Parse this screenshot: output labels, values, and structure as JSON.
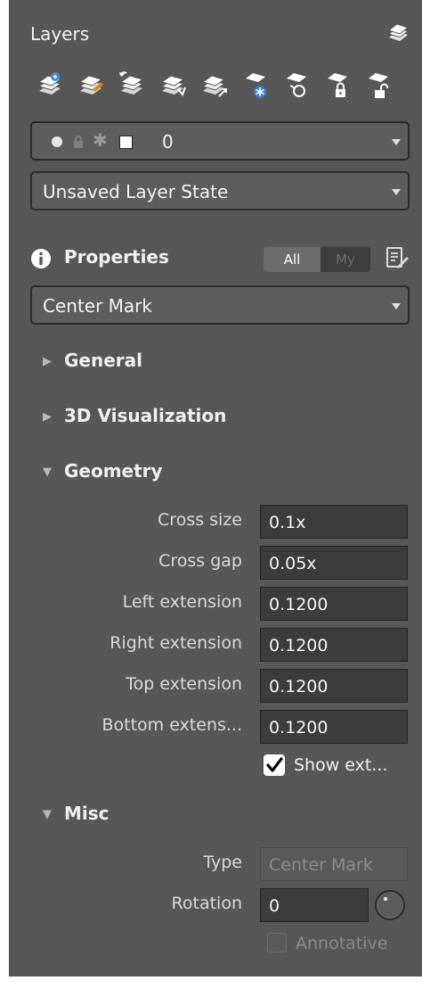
{
  "header": {
    "title": "Layers",
    "layers_icon": "layer-stack-icon"
  },
  "toolbar": {
    "buttons": [
      {
        "name": "new-layer-icon"
      },
      {
        "name": "layer-color-icon"
      },
      {
        "name": "layer-previous-icon"
      },
      {
        "name": "layer-walk-icon"
      },
      {
        "name": "layer-match-icon"
      },
      {
        "name": "layer-freeze-icon"
      },
      {
        "name": "layer-off-icon"
      },
      {
        "name": "layer-lock-icon"
      },
      {
        "name": "layer-unlock-icon"
      }
    ]
  },
  "layer_dropdown": {
    "value": "0",
    "swatch_color": "#ffffff"
  },
  "layer_state": {
    "value": "Unsaved Layer State"
  },
  "properties": {
    "title": "Properties",
    "toggle_all": "All",
    "toggle_my": "My",
    "object_type": "Center Mark"
  },
  "sections": {
    "general": "General",
    "viz": "3D Visualization",
    "geometry": "Geometry",
    "misc": "Misc"
  },
  "geometry": {
    "cross_size_label": "Cross size",
    "cross_size_value": "0.1x",
    "cross_gap_label": "Cross gap",
    "cross_gap_value": "0.05x",
    "left_ext_label": "Left extension",
    "left_ext_value": "0.1200",
    "right_ext_label": "Right extension",
    "right_ext_value": "0.1200",
    "top_ext_label": "Top extension",
    "top_ext_value": "0.1200",
    "bottom_ext_label": "Bottom extens...",
    "bottom_ext_value": "0.1200",
    "show_ext_label": "Show ext...",
    "show_ext_checked": true
  },
  "misc": {
    "type_label": "Type",
    "type_value": "Center Mark",
    "rotation_label": "Rotation",
    "rotation_value": "0",
    "annotative_label": "Annotative",
    "annotative_checked": false
  }
}
